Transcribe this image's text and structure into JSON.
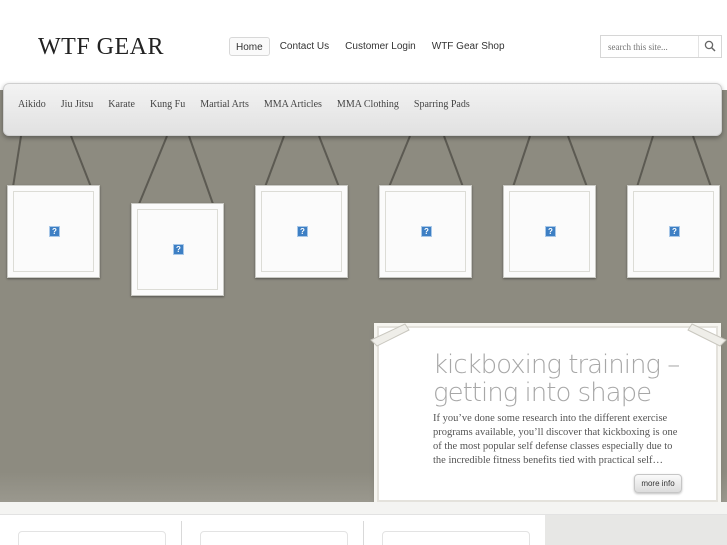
{
  "site": {
    "logo_text": "WTF GEAR"
  },
  "top_nav": {
    "items": [
      "Home",
      "Contact Us",
      "Customer Login",
      "WTF Gear Shop"
    ],
    "active": "Home"
  },
  "search": {
    "placeholder": "search this site...",
    "button_icon": "search-icon"
  },
  "categories": [
    "Aikido",
    "Jiu Jitsu",
    "Karate",
    "Kung Fu",
    "Martial Arts",
    "MMA Articles",
    "MMA Clothing",
    "Sparring Pads"
  ],
  "gallery": {
    "frames": [
      {
        "image": "?"
      },
      {
        "image": "?"
      },
      {
        "image": "?"
      },
      {
        "image": "?"
      },
      {
        "image": "?"
      },
      {
        "image": "?"
      }
    ]
  },
  "feature": {
    "title": "kickboxing training – getting into shape",
    "excerpt": "If you’ve done some research into the different exercise programs available, you’ll discover that kickboxing is one of the most popular self defense classes especially due to the incredible fitness benefits tied with practical self…",
    "more_label": "more info"
  },
  "colors": {
    "wall": "#8d8b80",
    "menu_bar": "#ebebeb",
    "title_gray": "#a7a7a7"
  }
}
